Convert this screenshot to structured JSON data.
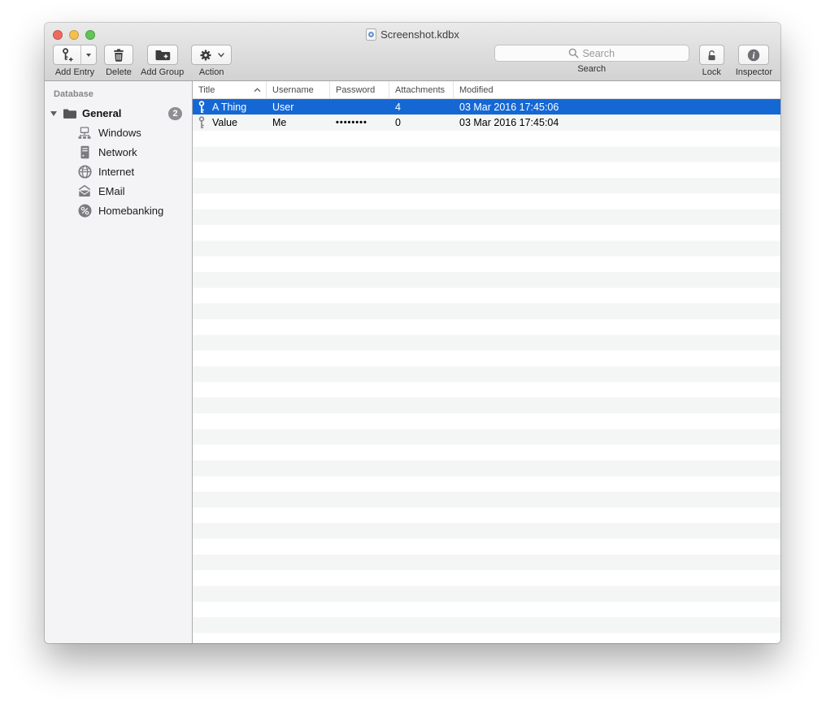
{
  "window": {
    "title": "Screenshot.kdbx"
  },
  "toolbar": {
    "add_entry": {
      "label": "Add Entry",
      "icon": "key-plus-icon",
      "has_dropdown": true
    },
    "delete": {
      "label": "Delete",
      "icon": "trash-icon"
    },
    "add_group": {
      "label": "Add Group",
      "icon": "folder-plus-icon"
    },
    "action": {
      "label": "Action",
      "icon": "gear-icon",
      "has_dropdown": true
    },
    "search": {
      "label": "Search",
      "placeholder": "Search",
      "value": "",
      "icon": "magnifier-icon"
    },
    "lock": {
      "label": "Lock",
      "icon": "padlock-open-icon"
    },
    "inspector": {
      "label": "Inspector",
      "icon": "info-icon"
    }
  },
  "sidebar": {
    "header": "Database",
    "root_group": {
      "label": "General",
      "badge": "2",
      "icon": "folder-icon",
      "expanded": true
    },
    "subgroups": [
      {
        "label": "Windows",
        "icon": "workgroup-icon"
      },
      {
        "label": "Network",
        "icon": "server-icon"
      },
      {
        "label": "Internet",
        "icon": "globe-icon"
      },
      {
        "label": "EMail",
        "icon": "envelope-icon"
      },
      {
        "label": "Homebanking",
        "icon": "percent-icon"
      }
    ]
  },
  "table": {
    "columns": [
      {
        "label": "Title",
        "sorted": "ascending"
      },
      {
        "label": "Username"
      },
      {
        "label": "Password"
      },
      {
        "label": "Attachments"
      },
      {
        "label": "Modified"
      }
    ],
    "rows": [
      {
        "icon": "key-icon",
        "title": "A Thing",
        "username": "User",
        "password": "",
        "attachments": "4",
        "modified": "03 Mar 2016 17:45:06",
        "selected": true
      },
      {
        "icon": "key-icon",
        "title": "Value",
        "username": "Me",
        "password": "••••••••",
        "attachments": "0",
        "modified": "03 Mar 2016 17:45:04",
        "selected": false
      }
    ]
  },
  "colors": {
    "selection_blue": "#1568d4",
    "row_stripe": "#f4f5f5",
    "sidebar_bg": "#f4f4f6",
    "badge_gray": "#8e8e93",
    "traffic_red": "#ec6a5e",
    "traffic_yellow": "#f5bf4f",
    "traffic_green": "#61c454"
  }
}
